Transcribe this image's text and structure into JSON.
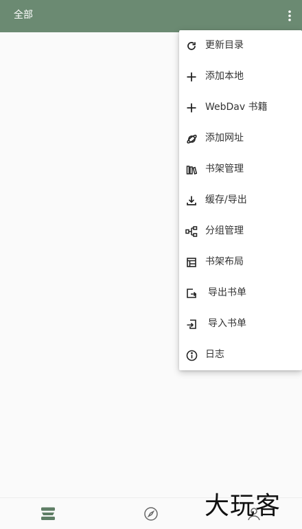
{
  "toolbar": {
    "title": "全部",
    "more_icon": "more-vert-icon"
  },
  "menu": {
    "items": [
      {
        "label": "更新目录",
        "icon": "refresh-icon"
      },
      {
        "label": "添加本地",
        "icon": "plus-icon"
      },
      {
        "label": "WebDav 书籍",
        "icon": "plus-icon"
      },
      {
        "label": "添加网址",
        "icon": "planet-icon"
      },
      {
        "label": "书架管理",
        "icon": "bookshelf-icon"
      },
      {
        "label": "缓存/导出",
        "icon": "download-icon"
      },
      {
        "label": "分组管理",
        "icon": "group-icon"
      },
      {
        "label": "书架布局",
        "icon": "layout-icon"
      },
      {
        "label": "导出书单",
        "icon": "export-icon"
      },
      {
        "label": "导入书单",
        "icon": "import-icon"
      },
      {
        "label": "日志",
        "icon": "info-icon"
      }
    ]
  },
  "bottom_nav": {
    "items": [
      {
        "name": "bookshelf",
        "icon": "bookshelf-stack-icon",
        "active": true
      },
      {
        "name": "discover",
        "icon": "compass-icon",
        "active": false
      },
      {
        "name": "my",
        "icon": "person-icon",
        "active": false
      }
    ]
  },
  "watermark": {
    "text": "大玩客"
  },
  "colors": {
    "toolbar": "#6b8a72",
    "accent": "#5e7d65",
    "menu_text": "#333333",
    "icon": "#222222",
    "background": "#fafafa"
  }
}
